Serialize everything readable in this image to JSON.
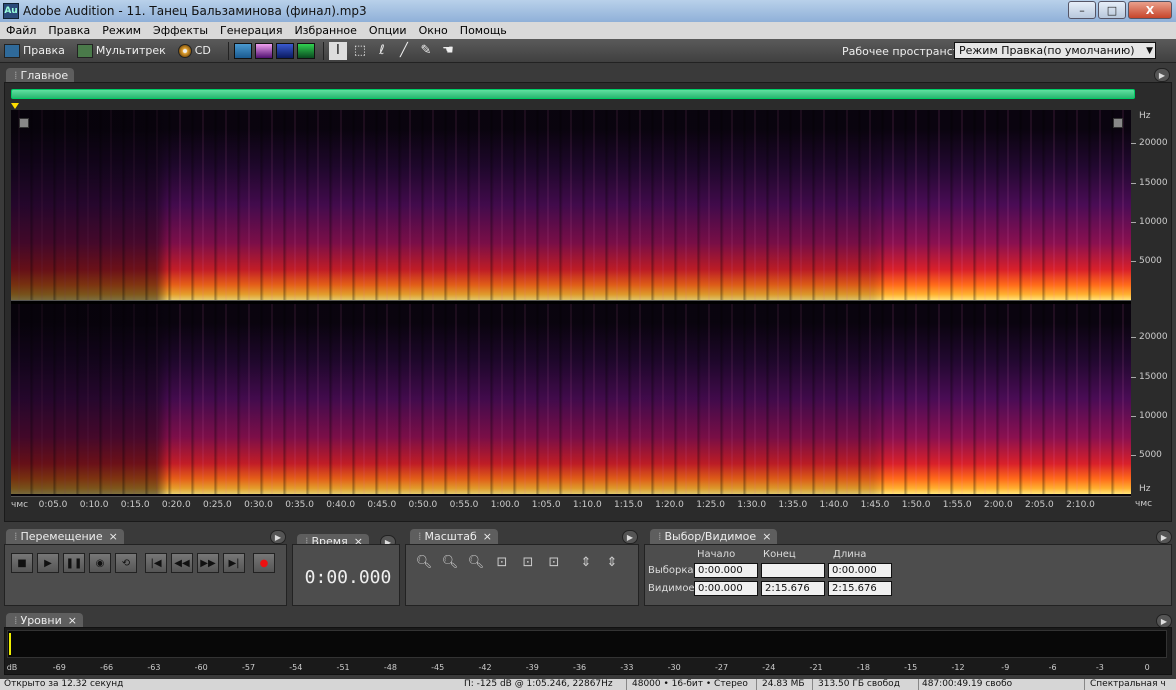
{
  "app": {
    "icon_text": "Au",
    "title": "Adobe Audition - 11. Танец Бальзаминова (финал).mp3"
  },
  "window_controls": {
    "minimize": "–",
    "maximize": "□",
    "close": "X"
  },
  "menu": [
    "Файл",
    "Правка",
    "Режим",
    "Эффекты",
    "Генерация",
    "Избранное",
    "Опции",
    "Окно",
    "Помощь"
  ],
  "toolbar": {
    "modes": [
      {
        "label": "Правка",
        "icon": "edit-view-icon"
      },
      {
        "label": "Мультитрек",
        "icon": "multitrack-icon"
      },
      {
        "label": "CD",
        "icon": "cd-icon"
      }
    ],
    "workspace_label": "Рабочее пространство:",
    "workspace_value": "Режим Правка(по умолчанию)"
  },
  "panels": {
    "main": "Главное",
    "transport": "Перемещение",
    "time": "Время",
    "zoom": "Масштаб",
    "selection": "Выбор/Видимое",
    "levels": "Уровни"
  },
  "spectrogram": {
    "hz_unit": "Hz",
    "hz_labels_top": [
      "20000",
      "15000",
      "10000",
      "5000"
    ],
    "hz_labels_bottom": [
      "20000",
      "15000",
      "10000",
      "5000",
      "Hz"
    ],
    "time_start": "чмс",
    "time_unit": "чмс",
    "time_labels": [
      "0:05.0",
      "0:10.0",
      "0:15.0",
      "0:20.0",
      "0:25.0",
      "0:30.0",
      "0:35.0",
      "0:40.0",
      "0:45.0",
      "0:50.0",
      "0:55.0",
      "1:00.0",
      "1:05.0",
      "1:10.0",
      "1:15.0",
      "1:20.0",
      "1:25.0",
      "1:30.0",
      "1:35.0",
      "1:40.0",
      "1:45.0",
      "1:50.0",
      "1:55.0",
      "2:00.0",
      "2:05.0",
      "2:10.0"
    ]
  },
  "time_display": "0:00.000",
  "selection": {
    "col_start": "Начало",
    "col_end": "Конец",
    "col_length": "Длина",
    "row_selection": "Выборка",
    "row_view": "Видимое",
    "sel_start": "0:00.000",
    "sel_end": "",
    "sel_length": "0:00.000",
    "view_start": "0:00.000",
    "view_end": "2:15.676",
    "view_length": "2:15.676"
  },
  "levels": {
    "db_labels": [
      "dB",
      "-69",
      "-66",
      "-63",
      "-60",
      "-57",
      "-54",
      "-51",
      "-48",
      "-45",
      "-42",
      "-39",
      "-36",
      "-33",
      "-30",
      "-27",
      "-24",
      "-21",
      "-18",
      "-15",
      "-12",
      "-9",
      "-6",
      "-3",
      "0"
    ]
  },
  "status": {
    "opened": "Открыто за 12.32 секунд",
    "cursor": "П: -125 dB @  1:05.246, 22867Hz",
    "format": "48000 • 16-бит • Стерео",
    "size": "24.83 МБ",
    "free_space": "313.50 ГБ свобод",
    "free_time": "487:00:49.19 свобо",
    "view_mode": "Спектральная ч"
  }
}
